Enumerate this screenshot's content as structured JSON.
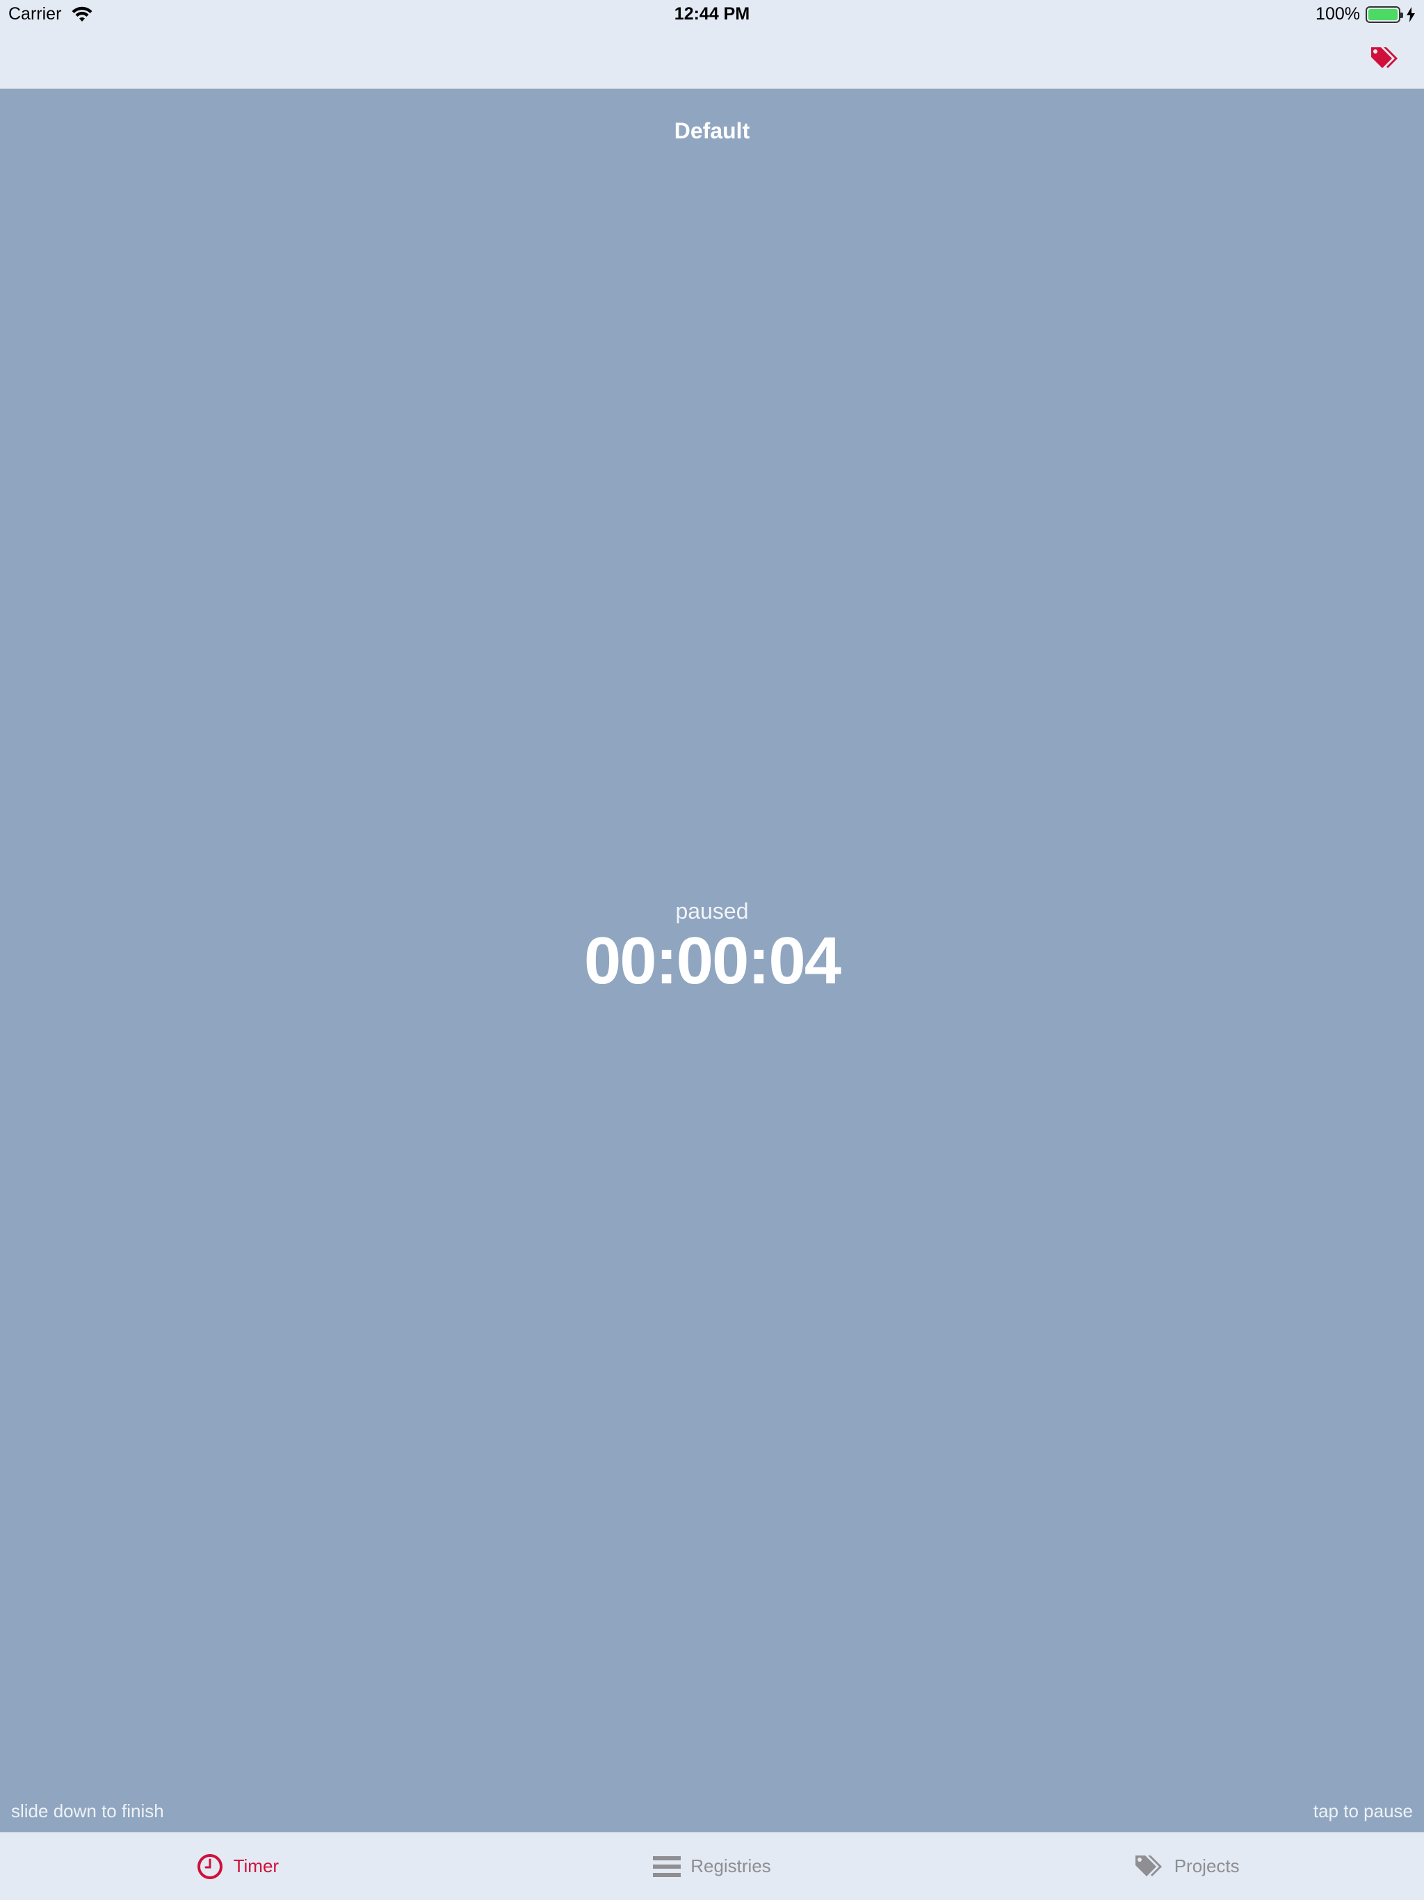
{
  "status_bar": {
    "carrier": "Carrier",
    "time": "12:44 PM",
    "battery_percent": "100%",
    "battery_level": 1.0,
    "wifi_icon": "wifi-icon",
    "charging_icon": "charging-bolt-icon"
  },
  "nav_bar": {
    "tag_icon": "tags-icon"
  },
  "timer": {
    "project_name": "Default",
    "state": "paused",
    "elapsed": "00:00:04",
    "hint_left": "slide down to finish",
    "hint_right": "tap to pause"
  },
  "tabs": [
    {
      "label": "Timer",
      "icon": "clock-icon",
      "active": true
    },
    {
      "label": "Registries",
      "icon": "list-icon",
      "active": false
    },
    {
      "label": "Projects",
      "icon": "tags-icon",
      "active": false
    }
  ],
  "colors": {
    "accent": "#d0103a",
    "timer_background": "#8fa5c0",
    "bar_background": "#e3eaf3",
    "inactive_tab": "#8e8e93",
    "battery": "#4cd964"
  }
}
